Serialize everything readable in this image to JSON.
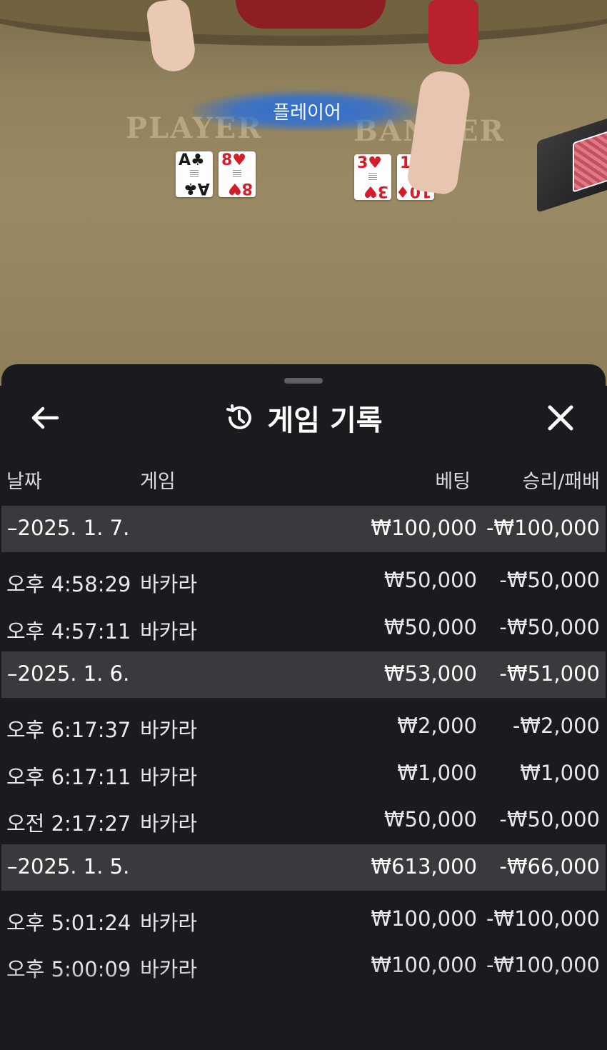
{
  "scene": {
    "player_label": "PLAYER",
    "banker_label": "BANKER",
    "result_banner": "플레이어",
    "player_cards": [
      {
        "rank": "A",
        "suit": "♣",
        "color": "black"
      },
      {
        "rank": "8",
        "suit": "♥",
        "color": "red"
      }
    ],
    "banker_cards": [
      {
        "rank": "3",
        "suit": "♥",
        "color": "red"
      },
      {
        "rank": "10",
        "suit": "♦",
        "color": "red"
      }
    ]
  },
  "sheet": {
    "title": "게임 기록",
    "icons": {
      "back": "arrow-left-icon",
      "history": "history-icon",
      "close": "close-icon"
    },
    "columns": {
      "date": "날짜",
      "game": "게임",
      "bet": "베팅",
      "result": "승리/패배"
    },
    "groups": [
      {
        "date": "–2025. 1. 7.",
        "bet": "₩100,000",
        "result": "-₩100,000",
        "items": [
          {
            "time": "오후 4:58:29",
            "game": "바카라",
            "bet": "₩50,000",
            "result": "-₩50,000"
          },
          {
            "time": "오후 4:57:11",
            "game": "바카라",
            "bet": "₩50,000",
            "result": "-₩50,000"
          }
        ]
      },
      {
        "date": "–2025. 1. 6.",
        "bet": "₩53,000",
        "result": "-₩51,000",
        "items": [
          {
            "time": "오후 6:17:37",
            "game": "바카라",
            "bet": "₩2,000",
            "result": "-₩2,000"
          },
          {
            "time": "오후 6:17:11",
            "game": "바카라",
            "bet": "₩1,000",
            "result": "₩1,000"
          },
          {
            "time": "오전 2:17:27",
            "game": "바카라",
            "bet": "₩50,000",
            "result": "-₩50,000"
          }
        ]
      },
      {
        "date": "–2025. 1. 5.",
        "bet": "₩613,000",
        "result": "-₩66,000",
        "items": [
          {
            "time": "오후 5:01:24",
            "game": "바카라",
            "bet": "₩100,000",
            "result": "-₩100,000"
          },
          {
            "time": "오후 5:00:09",
            "game": "바카라",
            "bet": "₩100,000",
            "result": "-₩100,000"
          }
        ]
      }
    ]
  }
}
